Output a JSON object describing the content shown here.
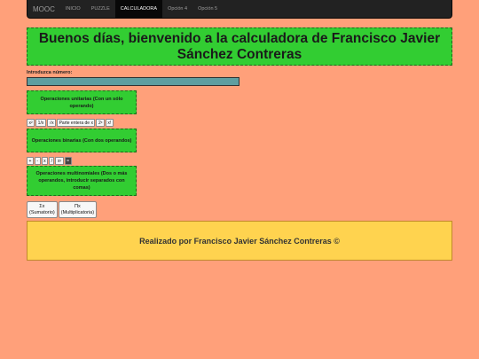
{
  "navbar": {
    "brand": "MOOC",
    "items": [
      "INICIO",
      "PUZZLE",
      "CALCULADORA",
      "Opción 4",
      "Opción 5"
    ],
    "active": "CALCULADORA"
  },
  "header": {
    "title": "Buenos días, bienvenido a la calculadora de Francisco Javier Sánchez Contreras"
  },
  "input": {
    "label": "Introduzca número:",
    "value": ""
  },
  "unary": {
    "heading": "Operaciones unitarias (Con un sólo operando)",
    "buttons": [
      "x²",
      "1/x",
      "√x",
      "Parte entera de x",
      "2ˣ",
      "x!"
    ]
  },
  "binary": {
    "heading": "Operaciones binarias (Con dos operandos)",
    "buttons": [
      "+",
      "-",
      "x",
      "/",
      "xʸ",
      "="
    ]
  },
  "multi": {
    "heading": "Operaciones multinomiales (Dos o más operandos, introducir separados con comas)",
    "buttons": [
      {
        "symbol": "Σx",
        "name": "(Sumatorio)"
      },
      {
        "symbol": "Πx",
        "name": "(Multiplicatoria)"
      }
    ]
  },
  "footer": {
    "text": "Realizado por Francisco Javier Sánchez Contreras ©"
  },
  "colors": {
    "background": "#ffa07a",
    "section_green": "#32cd32",
    "footer_yellow": "#ffd34f",
    "navbar": "#222222",
    "input_teal": "#5f9ea0"
  }
}
